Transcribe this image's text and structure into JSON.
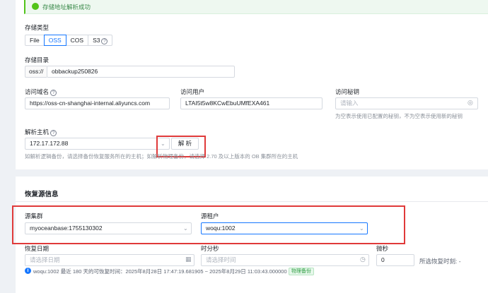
{
  "toast": {
    "text": "存储地址解析成功"
  },
  "storage_type": {
    "label": "存储类型",
    "options": [
      "File",
      "OSS",
      "COS",
      "S3"
    ],
    "selected": "OSS"
  },
  "storage_dir": {
    "label": "存储目录",
    "prefix": "oss://",
    "value": "obbackup250826"
  },
  "access_domain": {
    "label": "访问域名",
    "value": "https://oss-cn-shanghai-internal.aliyuncs.com"
  },
  "access_user": {
    "label": "访问用户",
    "value": "LTAI5t5w8KCwEbuUMfEXA461"
  },
  "access_secret": {
    "label": "访问秘钥",
    "placeholder": "请输入",
    "hint": "为空表示使用已配置的秘钥，不为空表示使用新的秘钥"
  },
  "parse_host": {
    "label": "解析主机",
    "value": "172.17.172.88",
    "button": "解 析",
    "hint": "如解析逻辑备份，请选择备份恢复服务所在的主机；如解析物理备份，请选择 2.70 及以上版本的 OB 集群所在的主机"
  },
  "restore_source": {
    "title": "恢复源信息",
    "cluster_label": "源集群",
    "cluster_value": "myoceanbase:1755130302",
    "tenant_label": "源租户",
    "tenant_value": "woqu:1002",
    "date_label": "恢复日期",
    "date_placeholder": "请选择日期",
    "time_label": "时分秒",
    "time_placeholder": "请选择时间",
    "ms_label": "微秒",
    "ms_value": "0",
    "selected_time_label": "所选恢复时刻: -",
    "info_text": "woqu:1002 最近 180 天的可恢复时间：2025年8月28日 17:47:19.681905 ~ 2025年8月29日 11:03:43.000000",
    "info_tag": "物理备份"
  },
  "icons": {
    "help": "?",
    "chevron": "⌄",
    "calendar": "▦",
    "clock": "◷",
    "eye_off": "◎",
    "info": "i",
    "check": "✓"
  }
}
